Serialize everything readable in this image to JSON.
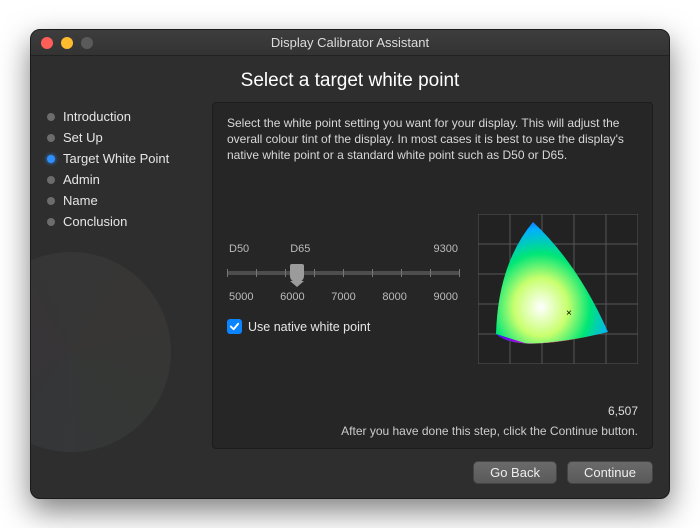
{
  "window_title": "Display Calibrator Assistant",
  "heading": "Select a target white point",
  "sidebar": {
    "items": [
      {
        "label": "Introduction"
      },
      {
        "label": "Set Up"
      },
      {
        "label": "Target White Point",
        "active": true
      },
      {
        "label": "Admin"
      },
      {
        "label": "Name"
      },
      {
        "label": "Conclusion"
      }
    ]
  },
  "description": "Select the white point setting you want for your display. This will adjust the overall colour tint of the display. In most cases it is best to use the display's native white point or a standard white point such as D50 or D65.",
  "slider": {
    "top_ticks": [
      "D50",
      "D65",
      "",
      "",
      "9300"
    ],
    "bottom_ticks": [
      "5000",
      "6000",
      "7000",
      "8000",
      "9000"
    ]
  },
  "checkbox_label": "Use native white point",
  "value_readout": "6,507",
  "hint": "After you have done this step, click the Continue button.",
  "buttons": {
    "back": "Go Back",
    "continue": "Continue"
  }
}
